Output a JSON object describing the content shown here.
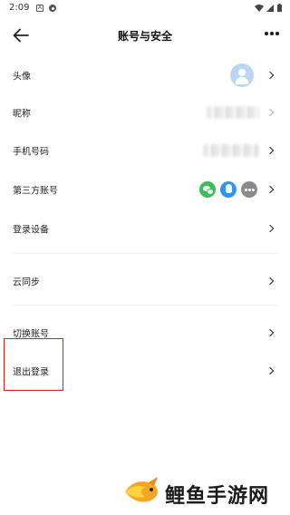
{
  "status_bar": {
    "time": "2:09",
    "icons": [
      "notification-a-icon",
      "settings-dot-icon",
      "wifi-icon",
      "signal-icon",
      "battery-icon"
    ]
  },
  "header": {
    "title": "账号与安全",
    "back_icon": "arrow-left-icon",
    "more_icon": "more-horizontal-icon"
  },
  "rows": [
    {
      "label": "头像",
      "right": "avatar"
    },
    {
      "label": "昵称",
      "right": "blurred-value"
    },
    {
      "label": "手机号码",
      "right": "blurred-value"
    },
    {
      "label": "第三方账号",
      "right": [
        "wechat-icon",
        "qq-icon",
        "more-icon"
      ]
    },
    {
      "label": "登录设备",
      "right": ""
    },
    {
      "label": "云同步",
      "right": ""
    },
    {
      "label": "切换账号",
      "right": ""
    },
    {
      "label": "退出登录",
      "right": ""
    }
  ],
  "colors": {
    "highlight_box": "#d9221c",
    "avatar_bg": "#b9d6f5",
    "wechat": "#3cbe5a",
    "qq": "#2f96f0"
  },
  "watermark": {
    "text": "鲤鱼手游网"
  }
}
